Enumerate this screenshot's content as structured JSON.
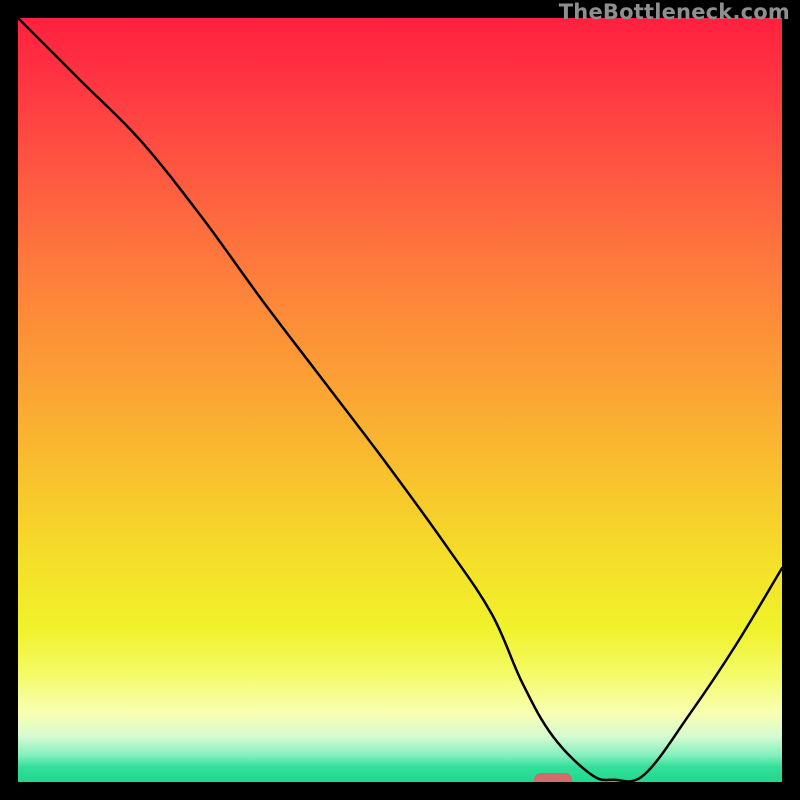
{
  "watermark": "TheBottleneck.com",
  "chart_data": {
    "type": "line",
    "title": "",
    "xlabel": "",
    "ylabel": "",
    "xlim": [
      0,
      100
    ],
    "ylim": [
      0,
      100
    ],
    "grid": false,
    "series": [
      {
        "name": "curve",
        "color": "#000000",
        "x": [
          0,
          8,
          16,
          24,
          32,
          40,
          48,
          56,
          62,
          66,
          70,
          75,
          78,
          82,
          88,
          94,
          100
        ],
        "y": [
          100,
          92,
          84,
          74,
          63,
          52.5,
          42,
          31,
          22,
          13,
          6,
          1,
          0.3,
          1,
          9,
          18,
          28
        ]
      }
    ],
    "marker": {
      "x_center": 70,
      "y": 0.3,
      "width_pct": 5,
      "color": "#d36a6b"
    }
  }
}
